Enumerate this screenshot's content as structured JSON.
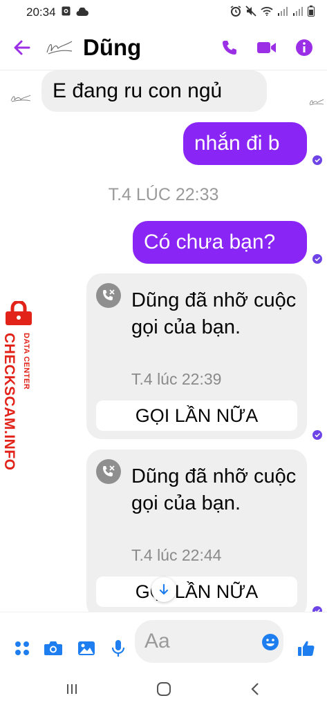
{
  "status_bar": {
    "time": "20:34",
    "icons": [
      "photo-icon",
      "cloud-icon",
      "alarm-icon",
      "mute-icon",
      "wifi-icon",
      "signal-icon",
      "signal-icon",
      "battery-icon"
    ]
  },
  "header": {
    "contact_name": "Dũng",
    "icons": {
      "back": "arrow-left-icon",
      "call": "phone-icon",
      "video": "video-icon",
      "info": "info-icon"
    }
  },
  "messages": [
    {
      "direction": "in",
      "text": "E đang ru con ngủ"
    },
    {
      "direction": "out",
      "text": "nhắn đi b"
    },
    {
      "type": "timestamp",
      "text": "T.4 LÚC 22:33"
    },
    {
      "direction": "out",
      "text": "Có chưa bạn?"
    }
  ],
  "missed_calls": [
    {
      "text": "Dũng đã nhỡ cuộc gọi của bạn.",
      "time": "T.4 lúc 22:39",
      "action": "GỌI LẦN NỮA"
    },
    {
      "text": "Dũng đã nhỡ cuộc gọi của bạn.",
      "time": "T.4 lúc 22:44",
      "action": "GỌI LẦN NỮA"
    }
  ],
  "watermark": {
    "main": "CHECKSCAM.INFO",
    "sub": "DATA CENTER"
  },
  "composer": {
    "placeholder": "Aa",
    "icons": [
      "apps-icon",
      "camera-icon",
      "image-icon",
      "mic-icon",
      "emoji-icon",
      "thumbs-up-icon"
    ]
  },
  "colors": {
    "accent": "#8a26f5",
    "icon": "#1e7ef0",
    "header_icon": "#9b2fe6",
    "watermark": "#e2231a"
  }
}
